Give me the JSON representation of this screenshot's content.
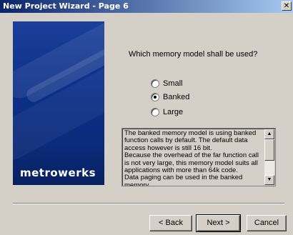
{
  "window": {
    "title": "New Project Wizard - Page  6",
    "close_glyph": "✕"
  },
  "banner": {
    "brand": "metrowerks"
  },
  "question": "Which memory model shall be used?",
  "options": [
    {
      "label": "Small",
      "checked": false
    },
    {
      "label": "Banked",
      "checked": true
    },
    {
      "label": "Large",
      "checked": false
    }
  ],
  "description": "The banked memory model is using banked function calls by default. The default data access however is still 16 bit.\nBecause the overhead of the far function call is not very large, this memory model suits all applications with more than 64k code.\nData paging can be used in the banked memory",
  "buttons": {
    "back": "< Back",
    "next": "Next >",
    "cancel": "Cancel"
  }
}
